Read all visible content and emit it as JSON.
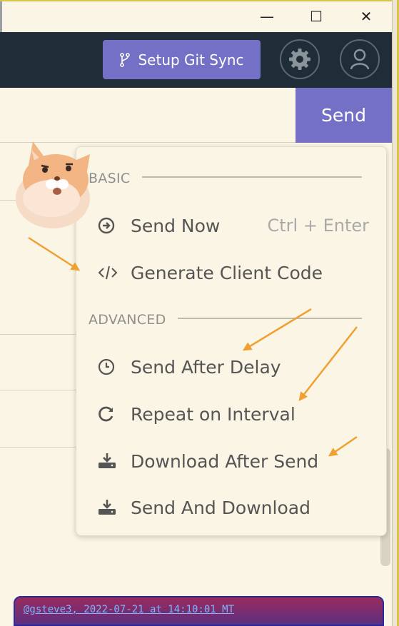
{
  "window": {
    "minimize_glyph": "—",
    "maximize_glyph": "☐",
    "close_glyph": "✕"
  },
  "header": {
    "git_sync_label": "Setup Git Sync",
    "settings_icon": "gear-icon",
    "account_icon": "user-icon"
  },
  "request": {
    "send_label": "Send"
  },
  "send_menu": {
    "basic_heading": "BASIC",
    "advanced_heading": "ADVANCED",
    "items": [
      {
        "label": "Send Now",
        "shortcut": "Ctrl + Enter",
        "icon": "arrow-circle-right-icon"
      },
      {
        "label": "Generate Client Code",
        "icon": "code-icon"
      },
      {
        "label": "Send After Delay",
        "icon": "clock-icon"
      },
      {
        "label": "Repeat on Interval",
        "icon": "refresh-icon"
      },
      {
        "label": "Download After Send",
        "icon": "download-icon"
      },
      {
        "label": "Send And Download",
        "icon": "download-icon"
      }
    ]
  },
  "footer": {
    "caption": "@gsteve3, 2022-07-21 at 14:10:01 MT"
  },
  "colors": {
    "accent": "#7470c6",
    "header_bg": "#1f2d38",
    "background": "#fbf5e5",
    "annotation_arrow": "#f0a030"
  }
}
